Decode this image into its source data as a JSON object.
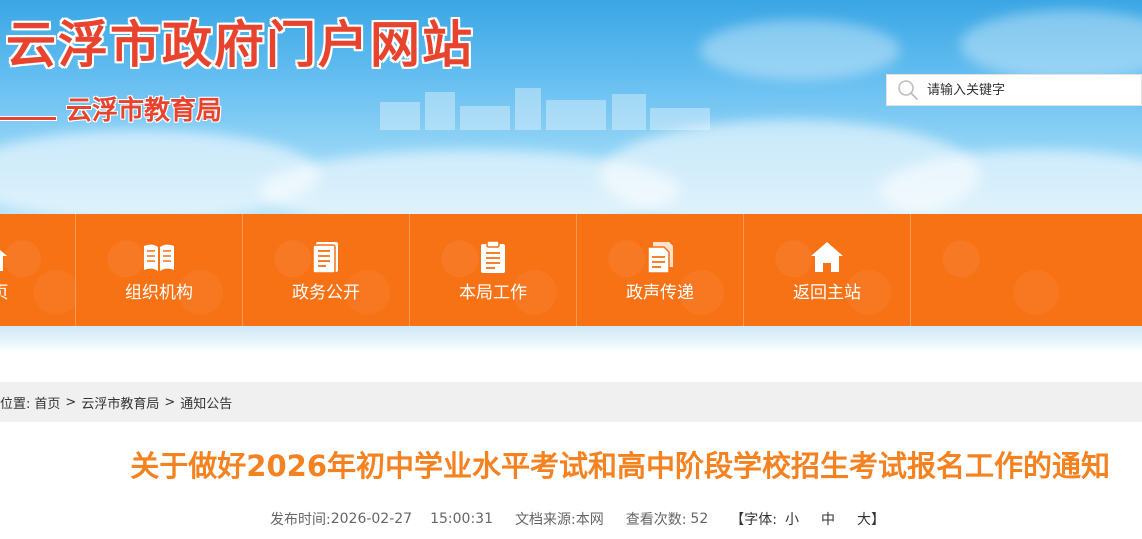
{
  "header": {
    "site_title": "云浮市政府门户网站",
    "dept_title": "云浮市教育局"
  },
  "search": {
    "placeholder": "请输入关键字",
    "icon": "search-icon"
  },
  "nav": {
    "items": [
      {
        "label": "首页",
        "icon": "home-icon"
      },
      {
        "label": "组织机构",
        "icon": "book-icon"
      },
      {
        "label": "政务公开",
        "icon": "document-icon"
      },
      {
        "label": "本局工作",
        "icon": "clipboard-icon"
      },
      {
        "label": "政声传递",
        "icon": "files-icon"
      },
      {
        "label": "返回主站",
        "icon": "home-icon"
      }
    ]
  },
  "breadcrumb": {
    "prefix": "位置:",
    "items": [
      "首页",
      "云浮市教育局",
      "通知公告"
    ],
    "separator": ">"
  },
  "article": {
    "title": "关于做好2026年初中学业水平考试和高中阶段学校招生考试报名工作的通知",
    "published_label": "发布时间:",
    "published_date": "2026-02-27",
    "published_time": "15:00:31",
    "source_label": "文档来源:",
    "source_value": "本网",
    "views_label": "查看次数:",
    "views_value": "52",
    "font_open": "【字体:",
    "font_small": "小",
    "font_medium": "中",
    "font_large": "大",
    "font_close": "】"
  },
  "colors": {
    "nav_bg": "#f77115",
    "title_color": "#f58220",
    "site_title_color": "#e8432e"
  }
}
